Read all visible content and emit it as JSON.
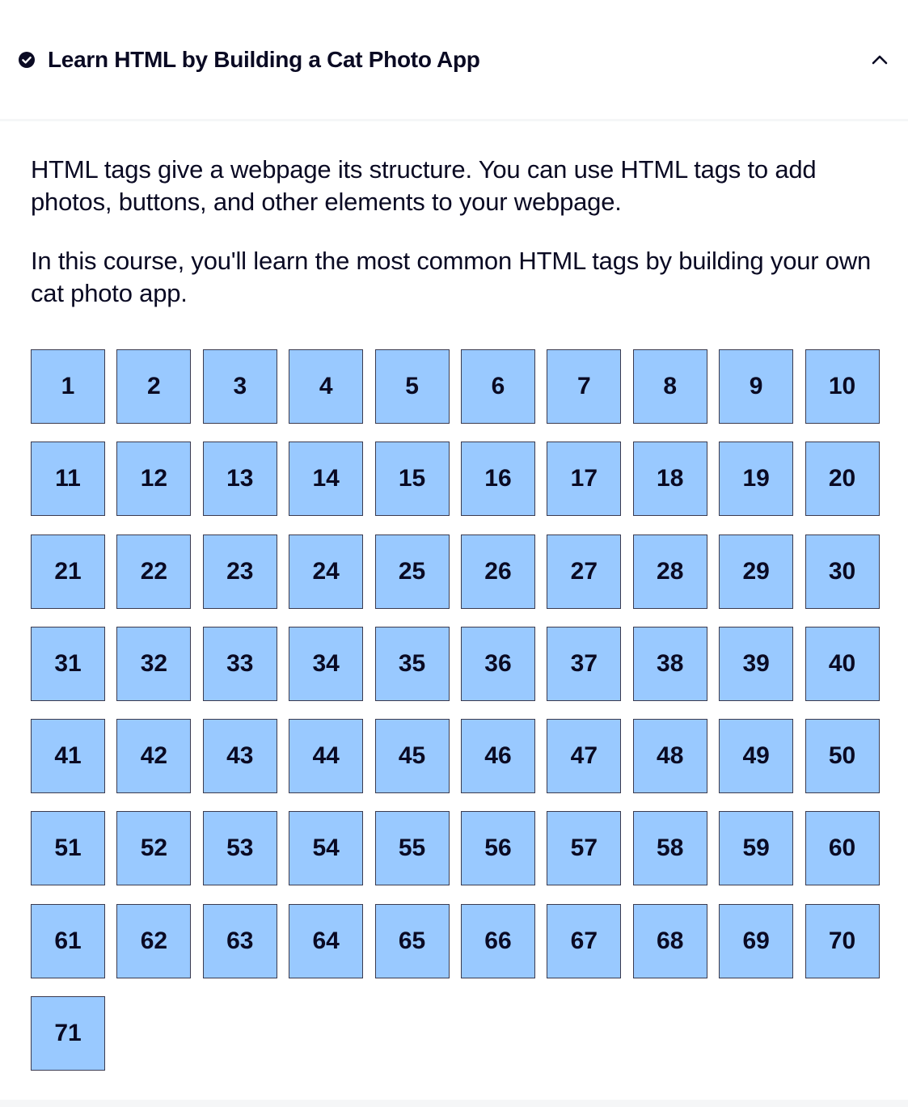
{
  "header": {
    "title": "Learn HTML by Building a Cat Photo App",
    "status_icon": "check-circle-icon",
    "toggle_icon": "chevron-up-icon"
  },
  "intro": [
    "HTML tags give a webpage its structure. You can use HTML tags to add photos, buttons, and other elements to your webpage.",
    "In this course, you'll learn the most common HTML tags by building your own cat photo app."
  ],
  "steps": [
    "1",
    "2",
    "3",
    "4",
    "5",
    "6",
    "7",
    "8",
    "9",
    "10",
    "11",
    "12",
    "13",
    "14",
    "15",
    "16",
    "17",
    "18",
    "19",
    "20",
    "21",
    "22",
    "23",
    "24",
    "25",
    "26",
    "27",
    "28",
    "29",
    "30",
    "31",
    "32",
    "33",
    "34",
    "35",
    "36",
    "37",
    "38",
    "39",
    "40",
    "41",
    "42",
    "43",
    "44",
    "45",
    "46",
    "47",
    "48",
    "49",
    "50",
    "51",
    "52",
    "53",
    "54",
    "55",
    "56",
    "57",
    "58",
    "59",
    "60",
    "61",
    "62",
    "63",
    "64",
    "65",
    "66",
    "67",
    "68",
    "69",
    "70",
    "71"
  ],
  "colors": {
    "step_background": "#99c9ff",
    "step_border": "#3b3b4f",
    "text": "#0a0a23"
  }
}
